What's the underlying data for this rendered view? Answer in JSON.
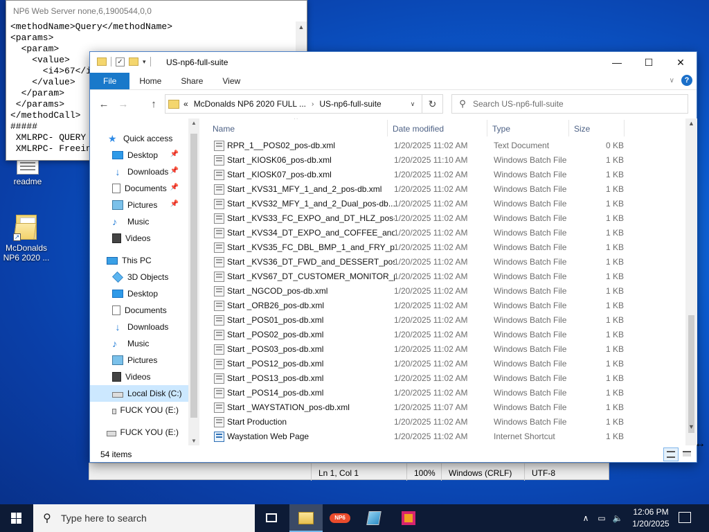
{
  "desktop": {
    "icons": [
      {
        "label": "readme"
      },
      {
        "label": "McDonalds NP6 2020 ..."
      }
    ]
  },
  "np6_window": {
    "title": "NP6 Web Server none,6,1900544,0,0",
    "lines": [
      "<methodName>Query</methodName>",
      "<params>",
      "  <param>",
      "    <value>",
      "      <i4>67</i4>",
      "    </value>",
      "  </param>",
      " </params>",
      "</methodCall>",
      "#####",
      " XMLRPC- QUERY",
      " XMLRPC- Freeing"
    ],
    "status": {
      "position": "Ln 1, Col 1",
      "zoom": "100%",
      "line_endings": "Windows (CRLF)",
      "encoding": "UTF-8"
    }
  },
  "explorer": {
    "title": "US-np6-full-suite",
    "ribbon_tabs": [
      "File",
      "Home",
      "Share",
      "View"
    ],
    "address": {
      "prefix": "«",
      "crumbs": [
        "McDonalds NP6 2020 FULL ...",
        "US-np6-full-suite"
      ]
    },
    "search_placeholder": "Search US-np6-full-suite",
    "nav": {
      "quick_access": "Quick access",
      "quick_items": [
        "Desktop",
        "Downloads",
        "Documents",
        "Pictures",
        "Music",
        "Videos"
      ],
      "this_pc": "This PC",
      "pc_items": [
        "3D Objects",
        "Desktop",
        "Documents",
        "Downloads",
        "Music",
        "Pictures",
        "Videos",
        "Local Disk (C:)",
        "FUCK YOU (E:)"
      ],
      "drive": "FUCK YOU (E:)"
    },
    "columns": [
      "Name",
      "Date modified",
      "Type",
      "Size"
    ],
    "files": [
      {
        "name": "RPR_1__POS02_pos-db.xml",
        "date": "1/20/2025 11:02 AM",
        "type": "Text Document",
        "size": "0 KB",
        "icon": "text-file-icon"
      },
      {
        "name": "Start _KIOSK06_pos-db.xml",
        "date": "1/20/2025 11:10 AM",
        "type": "Windows Batch File",
        "size": "1 KB",
        "icon": "batch-file-icon"
      },
      {
        "name": "Start _KIOSK07_pos-db.xml",
        "date": "1/20/2025 11:02 AM",
        "type": "Windows Batch File",
        "size": "1 KB",
        "icon": "batch-file-icon"
      },
      {
        "name": "Start _KVS31_MFY_1_and_2_pos-db.xml",
        "date": "1/20/2025 11:02 AM",
        "type": "Windows Batch File",
        "size": "1 KB",
        "icon": "batch-file-icon"
      },
      {
        "name": "Start _KVS32_MFY_1_and_2_Dual_pos-db....",
        "date": "1/20/2025 11:02 AM",
        "type": "Windows Batch File",
        "size": "1 KB",
        "icon": "batch-file-icon"
      },
      {
        "name": "Start _KVS33_FC_EXPO_and_DT_HLZ_pos-...",
        "date": "1/20/2025 11:02 AM",
        "type": "Windows Batch File",
        "size": "1 KB",
        "icon": "batch-file-icon"
      },
      {
        "name": "Start _KVS34_DT_EXPO_and_COFFEE_and_...",
        "date": "1/20/2025 11:02 AM",
        "type": "Windows Batch File",
        "size": "1 KB",
        "icon": "batch-file-icon"
      },
      {
        "name": "Start _KVS35_FC_DBL_BMP_1_and_FRY_p...",
        "date": "1/20/2025 11:02 AM",
        "type": "Windows Batch File",
        "size": "1 KB",
        "icon": "batch-file-icon"
      },
      {
        "name": "Start _KVS36_DT_FWD_and_DESSERT_pos-...",
        "date": "1/20/2025 11:02 AM",
        "type": "Windows Batch File",
        "size": "1 KB",
        "icon": "batch-file-icon"
      },
      {
        "name": "Start _KVS67_DT_CUSTOMER_MONITOR_p...",
        "date": "1/20/2025 11:02 AM",
        "type": "Windows Batch File",
        "size": "1 KB",
        "icon": "batch-file-icon"
      },
      {
        "name": "Start _NGCOD_pos-db.xml",
        "date": "1/20/2025 11:02 AM",
        "type": "Windows Batch File",
        "size": "1 KB",
        "icon": "batch-file-icon"
      },
      {
        "name": "Start _ORB26_pos-db.xml",
        "date": "1/20/2025 11:02 AM",
        "type": "Windows Batch File",
        "size": "1 KB",
        "icon": "batch-file-icon"
      },
      {
        "name": "Start _POS01_pos-db.xml",
        "date": "1/20/2025 11:02 AM",
        "type": "Windows Batch File",
        "size": "1 KB",
        "icon": "batch-file-icon"
      },
      {
        "name": "Start _POS02_pos-db.xml",
        "date": "1/20/2025 11:02 AM",
        "type": "Windows Batch File",
        "size": "1 KB",
        "icon": "batch-file-icon"
      },
      {
        "name": "Start _POS03_pos-db.xml",
        "date": "1/20/2025 11:02 AM",
        "type": "Windows Batch File",
        "size": "1 KB",
        "icon": "batch-file-icon"
      },
      {
        "name": "Start _POS12_pos-db.xml",
        "date": "1/20/2025 11:02 AM",
        "type": "Windows Batch File",
        "size": "1 KB",
        "icon": "batch-file-icon"
      },
      {
        "name": "Start _POS13_pos-db.xml",
        "date": "1/20/2025 11:02 AM",
        "type": "Windows Batch File",
        "size": "1 KB",
        "icon": "batch-file-icon"
      },
      {
        "name": "Start _POS14_pos-db.xml",
        "date": "1/20/2025 11:02 AM",
        "type": "Windows Batch File",
        "size": "1 KB",
        "icon": "batch-file-icon"
      },
      {
        "name": "Start _WAYSTATION_pos-db.xml",
        "date": "1/20/2025 11:07 AM",
        "type": "Windows Batch File",
        "size": "1 KB",
        "icon": "batch-file-icon"
      },
      {
        "name": "Start Production",
        "date": "1/20/2025 11:02 AM",
        "type": "Windows Batch File",
        "size": "1 KB",
        "icon": "batch-file-icon"
      },
      {
        "name": "Waystation Web Page",
        "date": "1/20/2025 11:02 AM",
        "type": "Internet Shortcut",
        "size": "1 KB",
        "icon": "internet-shortcut-icon"
      }
    ],
    "item_count": "54 items"
  },
  "taskbar": {
    "search_placeholder": "Type here to search",
    "np6_badge": "NP6",
    "time": "12:06 PM",
    "date": "1/20/2025"
  }
}
